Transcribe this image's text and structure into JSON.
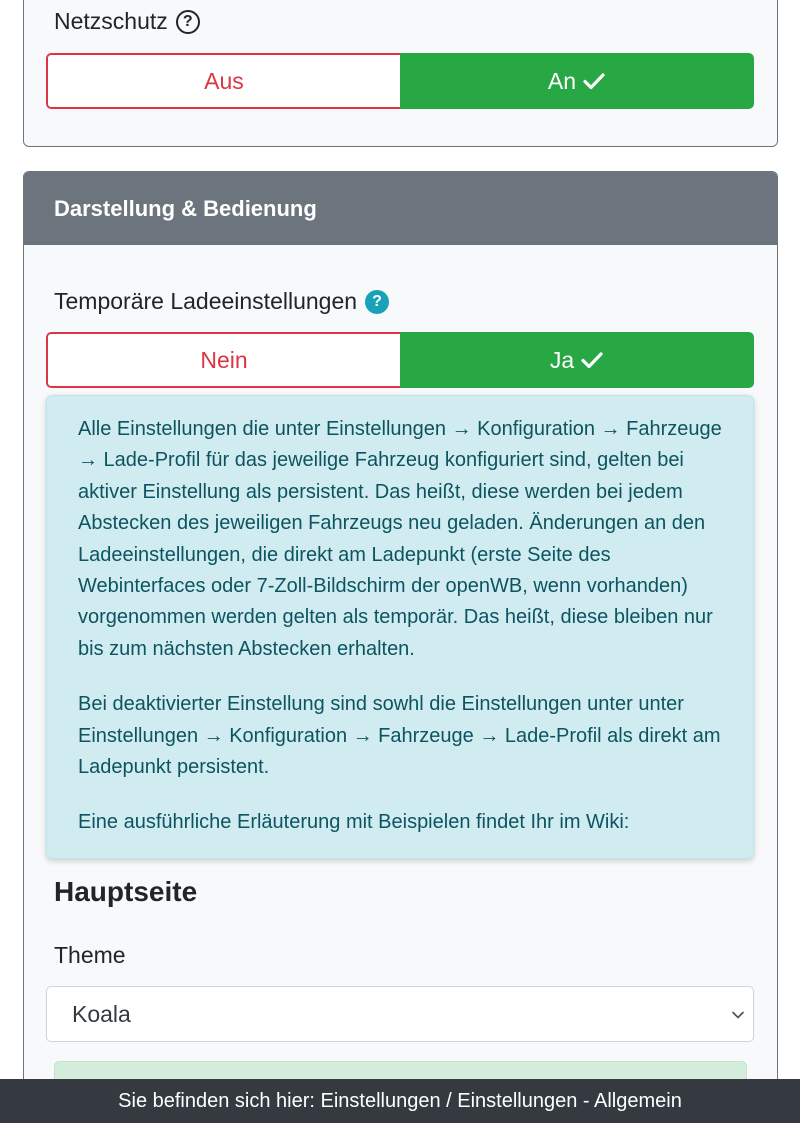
{
  "netzschutz": {
    "label": "Netzschutz",
    "help_icon": "question-circle-outline-icon",
    "off_label": "Aus",
    "on_label": "An",
    "selected": "An"
  },
  "darstellung": {
    "header": "Darstellung & Bedienung",
    "temp_settings": {
      "label": "Temporäre Ladeeinstellungen",
      "help_icon": "question-circle-filled-icon",
      "off_label": "Nein",
      "on_label": "Ja",
      "selected": "Ja"
    },
    "info": {
      "paragraph1": "Alle Einstellungen die unter Einstellungen → Konfiguration → Fahrzeuge → Lade-Profil für das jeweilige Fahrzeug konfiguriert sind, gelten bei aktiver Einstellung als persistent. Das heißt, diese werden bei jedem Abstecken des jeweiligen Fahrzeugs neu geladen. Änderungen an den Ladeeinstellungen, die direkt am Ladepunkt (erste Seite des Webinterfaces oder 7-Zoll-Bildschirm der openWB, wenn vorhanden) vorgenommen werden gelten als temporär. Das heißt, diese bleiben nur bis zum nächsten Abstecken erhalten.",
      "paragraph2": "Bei deaktivierter Einstellung sind sowhl die Einstellungen unter unter Einstellungen → Konfiguration → Fahrzeuge → Lade-Profil als direkt am Ladepunkt persistent.",
      "paragraph3": "Eine ausführliche Erläuterung mit Beispielen findet Ihr im Wiki:"
    },
    "hauptseite": {
      "heading": "Hauptseite",
      "theme_label": "Theme",
      "theme_value": "Koala"
    }
  },
  "footer": {
    "breadcrumb": "Sie befinden sich hier: Einstellungen / Einstellungen - Allgemein"
  },
  "colors": {
    "success": "#28a745",
    "danger": "#dc3545",
    "info_bg": "#d1ecf1",
    "info_text": "#0c5460",
    "header_bg": "#6c757d",
    "footer_bg": "#343a40"
  }
}
